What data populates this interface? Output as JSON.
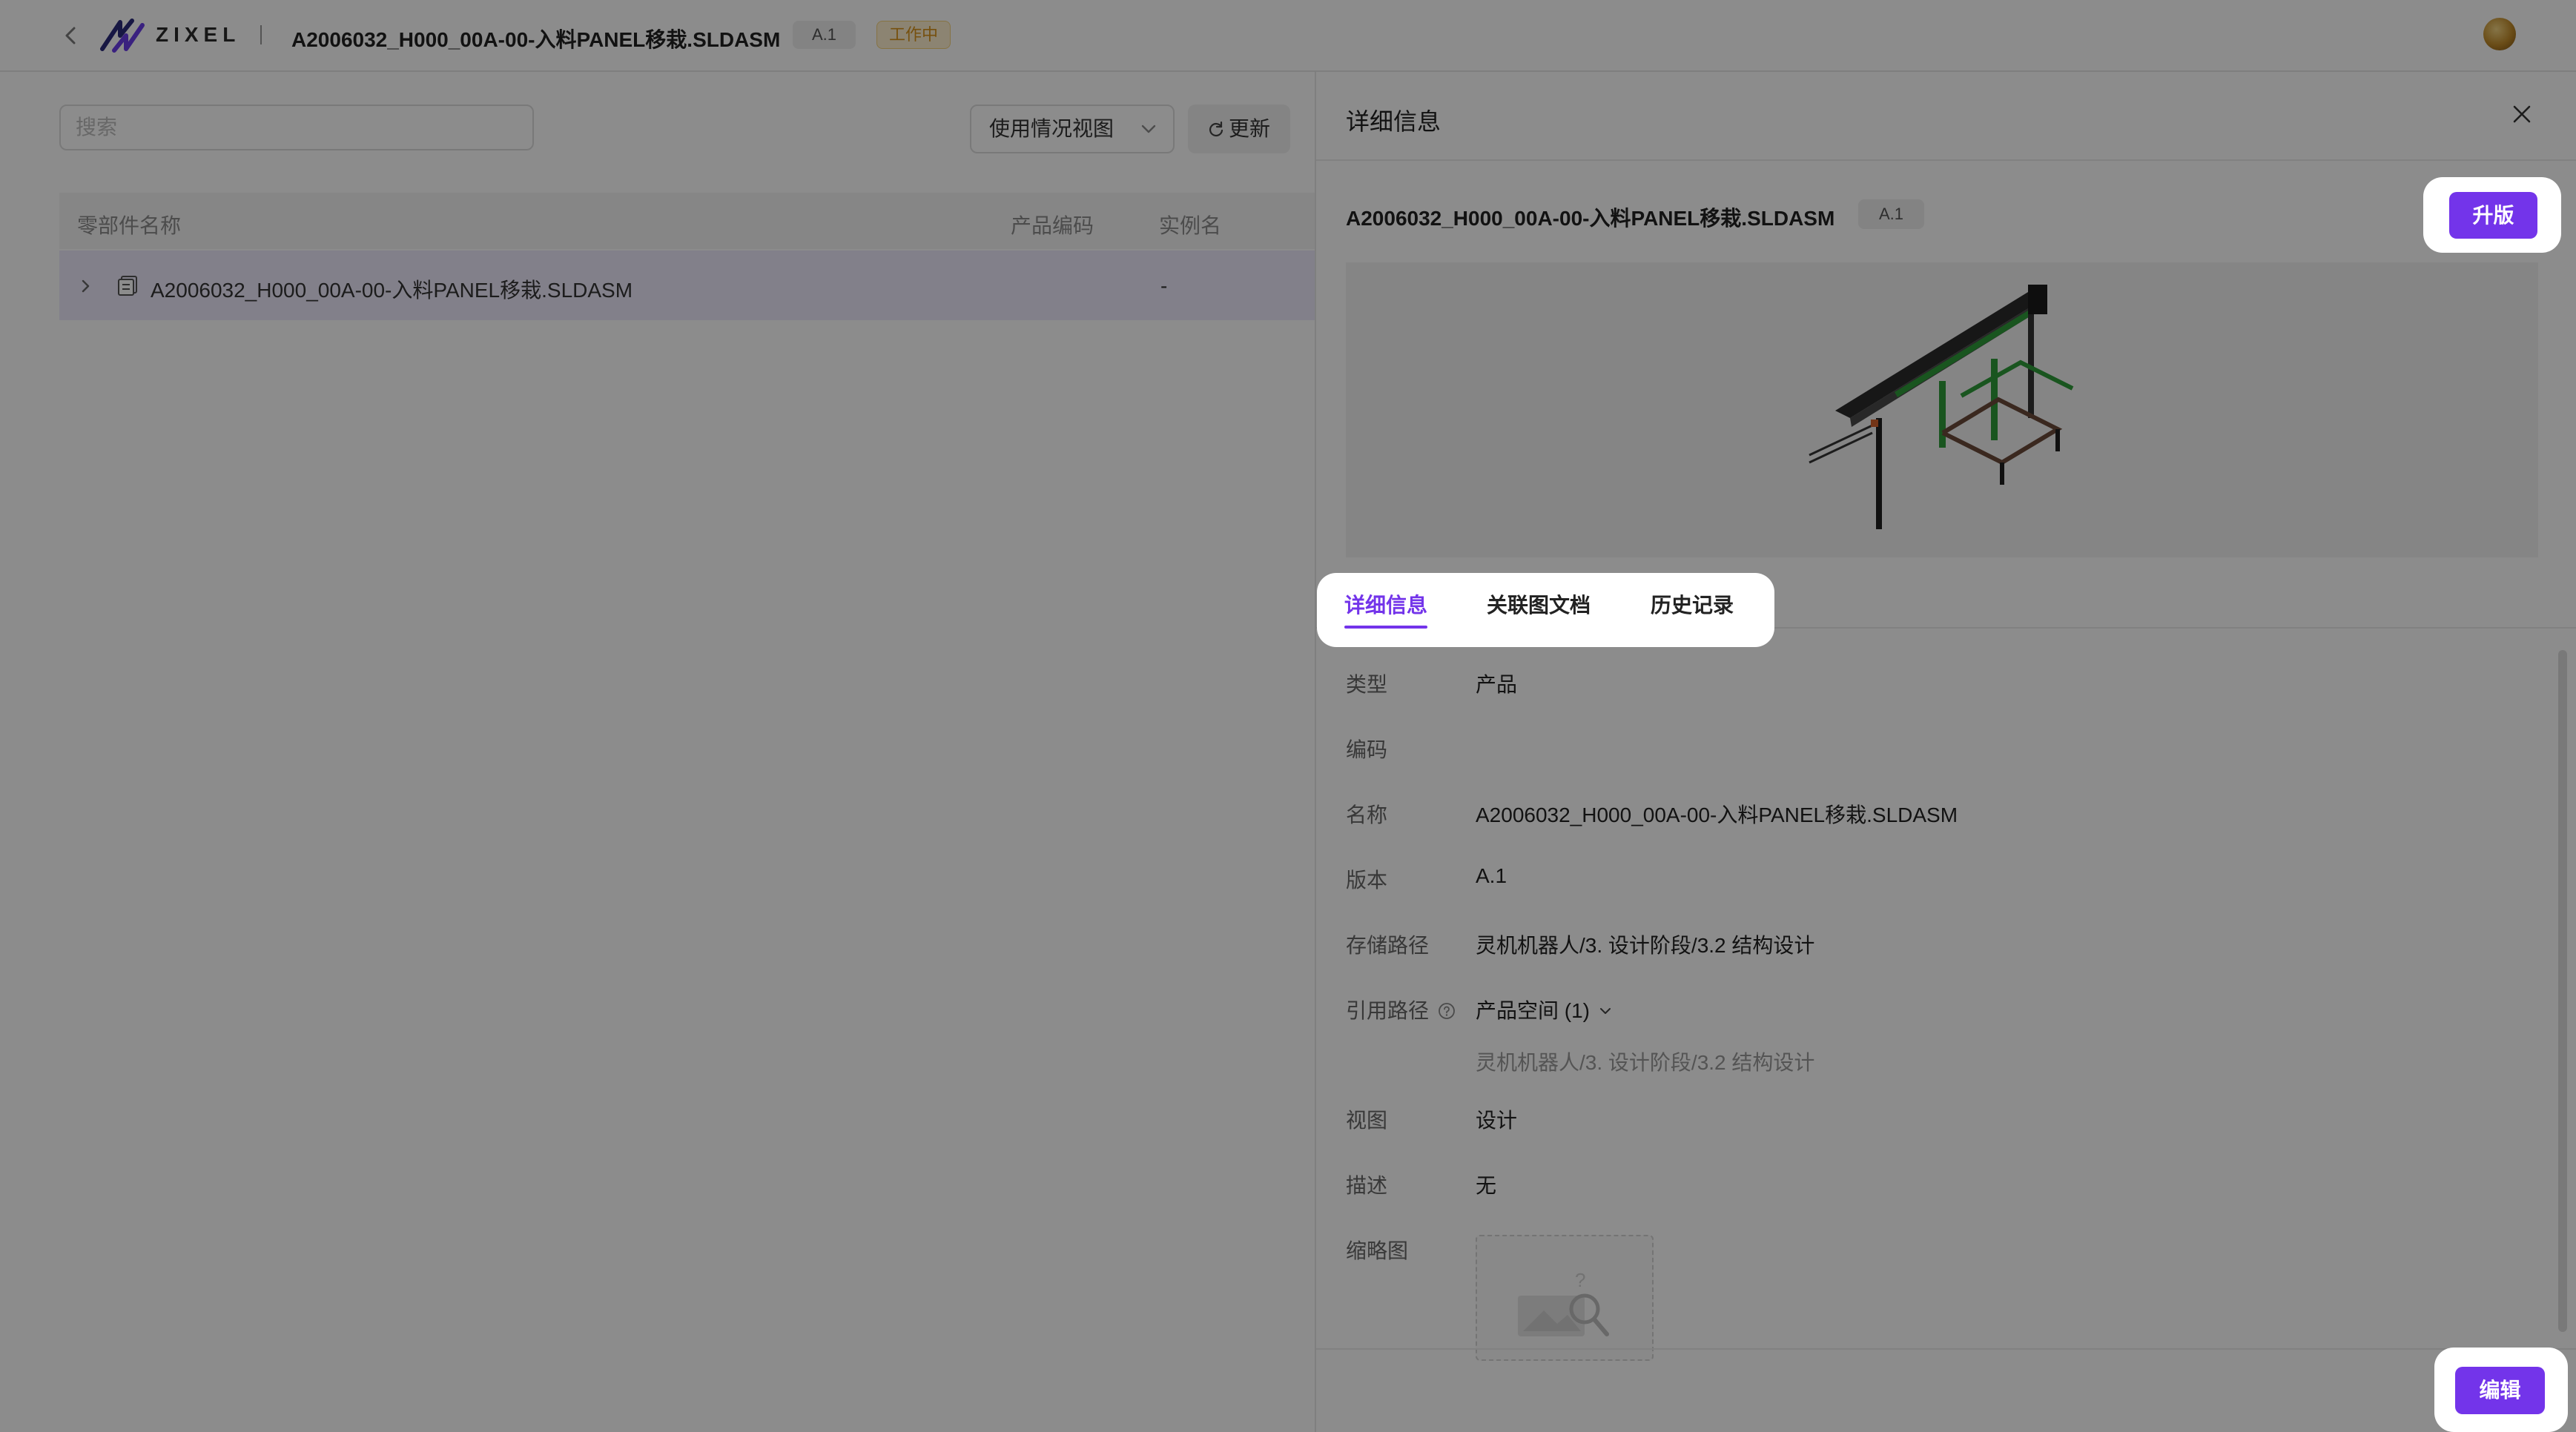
{
  "header": {
    "logo_text": "ZIXEL",
    "file_title": "A2006032_H000_00A-00-入料PANEL移栽.SLDASM",
    "version_badge": "A.1",
    "status_badge": "工作中"
  },
  "left_pane": {
    "search_placeholder": "搜索",
    "view_select_value": "使用情况视图",
    "refresh_label": "更新",
    "columns": [
      "零部件名称",
      "产品编码",
      "实例名"
    ],
    "rows": [
      {
        "name": "A2006032_H000_00A-00-入料PANEL移栽.SLDASM",
        "code": "",
        "instance": "-"
      }
    ]
  },
  "drawer": {
    "title": "详细信息",
    "item_title": "A2006032_H000_00A-00-入料PANEL移栽.SLDASM",
    "item_version": "A.1",
    "upgrade_button": "升版",
    "tabs": [
      "详细信息",
      "关联图文档",
      "历史记录"
    ],
    "active_tab": "详细信息",
    "properties": {
      "type_label": "类型",
      "type_value": "产品",
      "code_label": "编码",
      "code_value": "",
      "name_label": "名称",
      "name_value": "A2006032_H000_00A-00-入料PANEL移栽.SLDASM",
      "version_label": "版本",
      "version_value": "A.1",
      "storage_label": "存储路径",
      "storage_value": "灵机机器人/3. 设计阶段/3.2 结构设计",
      "ref_label": "引用路径",
      "ref_value": "产品空间 (1)",
      "ref_sub_value": "灵机机器人/3. 设计阶段/3.2 结构设计",
      "view_label": "视图",
      "view_value": "设计",
      "desc_label": "描述",
      "desc_value": "无",
      "thumb_label": "缩略图"
    },
    "edit_button": "编辑"
  },
  "colors": {
    "accent": "#7334ea",
    "status_text": "#d8921b",
    "selected_row": "#ede9fb",
    "overlay": "rgba(0,0,0,0.45)"
  },
  "icons": [
    "back-icon",
    "zixel-logo-icon",
    "chevron-down-icon",
    "refresh-icon",
    "expand-arrow-icon",
    "assembly-icon",
    "close-icon",
    "help-icon",
    "image-placeholder-icon",
    "avatar"
  ]
}
